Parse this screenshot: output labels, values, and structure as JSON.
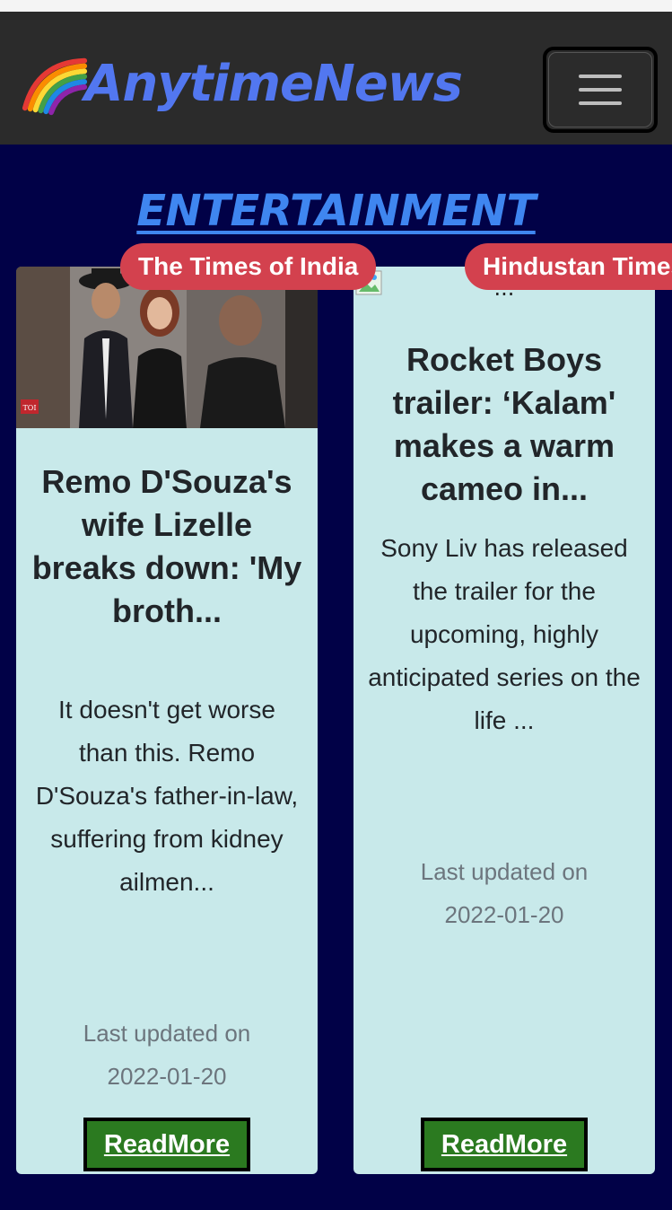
{
  "navbar": {
    "brand": "AnytimeNews",
    "logo_icon": "rainbow-icon",
    "menu_icon": "hamburger-menu-icon"
  },
  "section": {
    "title": "ENTERTAINMENT"
  },
  "articles": [
    {
      "source": "The Times of India",
      "headline": "Remo D'Souza's wife Lizelle breaks down: 'My broth...",
      "summary": "It doesn't get worse than this. Remo D'Souza's father-in-law, suffering from kidney ailmen...",
      "updated_label": "Last updated on",
      "updated_date": "2022-01-20",
      "image_badge": "TOI",
      "read_more": "ReadMore"
    },
    {
      "source": "Hindustan Times",
      "image_alt": "...",
      "headline": "Rocket Boys trailer: ‘Kalam' makes a warm cameo in...",
      "summary": "Sony Liv has released the trailer for the upcoming, highly anticipated series on the life ...",
      "updated_label": "Last updated on",
      "updated_date": "2022-01-20",
      "read_more": "ReadMore"
    }
  ],
  "colors": {
    "navbar_bg": "#2b2b2b",
    "brand": "#5277f0",
    "page_bg": "#010147",
    "section_title": "#3f86f0",
    "card_bg": "#c8e9ea",
    "badge_bg": "#d3414e",
    "button_bg": "#2b7a20"
  }
}
